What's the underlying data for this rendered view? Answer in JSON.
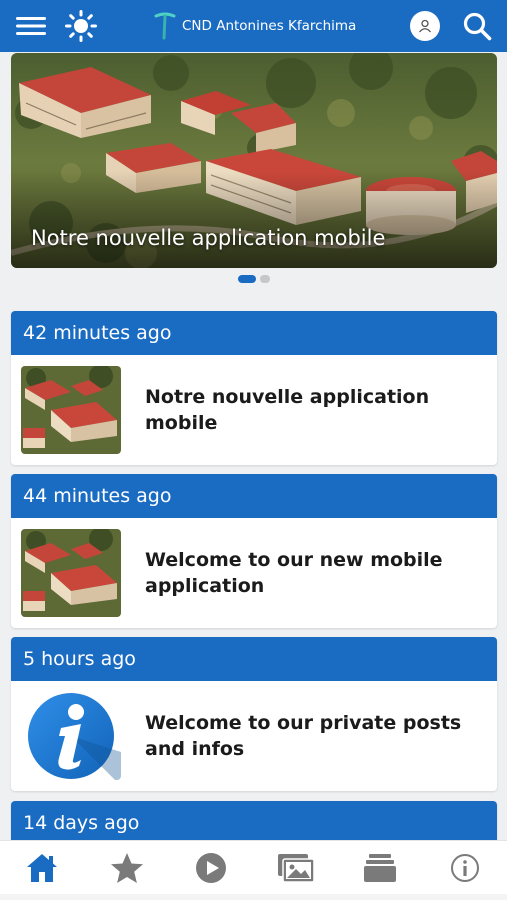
{
  "header": {
    "title": "CND Antonines Kfarchima",
    "brand_color": "#1a6cc3",
    "icons": [
      "hamburger-menu-icon",
      "sun-icon",
      "logo-icon",
      "user-icon",
      "search-icon"
    ]
  },
  "slider": {
    "caption": "Notre nouvelle application mobile",
    "slide_count": 2,
    "active_index": 0
  },
  "posts": [
    {
      "time": "42 minutes ago",
      "title": "Notre nouvelle application mobile",
      "thumb": "campus-photo"
    },
    {
      "time": "44 minutes ago",
      "title": "Welcome to our new mobile application",
      "thumb": "campus-photo"
    },
    {
      "time": "5 hours ago",
      "title": "Welcome to our private posts and infos",
      "thumb": "info-icon"
    },
    {
      "time": "14 days ago",
      "title": "",
      "thumb": ""
    }
  ],
  "bottom_nav": {
    "items": [
      "home-icon",
      "star-icon",
      "play-icon",
      "gallery-icon",
      "stack-icon",
      "info-icon"
    ],
    "active": "home-icon",
    "active_color": "#1a6cc3",
    "inactive_color": "#7a7a7a"
  }
}
